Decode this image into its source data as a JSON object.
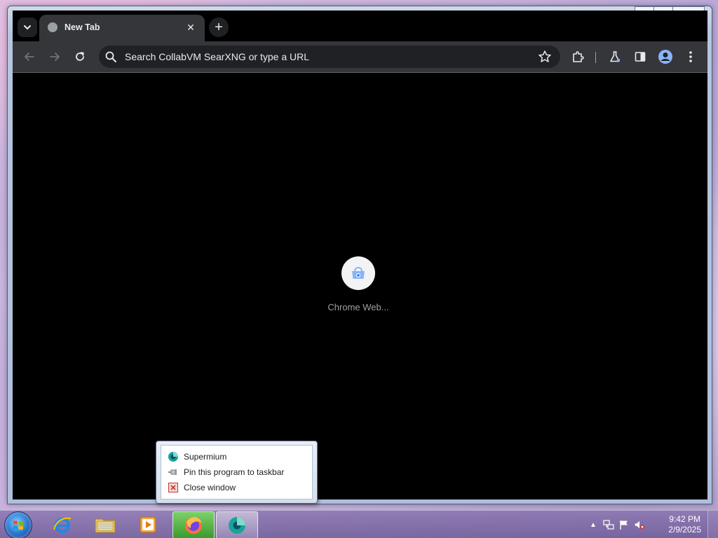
{
  "browser": {
    "tab": {
      "title": "New Tab",
      "close_glyph": "✕"
    },
    "new_tab_glyph": "+",
    "toolbar": {
      "omnibox_placeholder": "Search CollabVM SearXNG or type a URL"
    },
    "content": {
      "shortcut_label": "Chrome Web..."
    }
  },
  "window_caption": {
    "minimize_glyph": "▁",
    "maximize_glyph": "▢",
    "close_glyph": "✕"
  },
  "jumplist": {
    "items": [
      {
        "label": "Supermium",
        "icon": "supermium-icon"
      },
      {
        "label": "Pin this program to taskbar",
        "icon": "pin-icon"
      },
      {
        "label": "Close window",
        "icon": "close-window-icon"
      }
    ]
  },
  "taskbar": {
    "apps": [
      {
        "name": "internet-explorer",
        "icon": "ie-icon"
      },
      {
        "name": "file-explorer",
        "icon": "folder-icon"
      },
      {
        "name": "media-player",
        "icon": "media-player-icon"
      },
      {
        "name": "firefox",
        "icon": "firefox-icon"
      },
      {
        "name": "supermium",
        "icon": "supermium-icon"
      }
    ],
    "tray": {
      "overflow_glyph": "▲",
      "time": "9:42 PM",
      "date": "2/9/2025"
    }
  },
  "colors": {
    "browser_frame": "#35363a",
    "page_background": "#000000",
    "omnibox": "#202124",
    "text_light": "#e8eaed",
    "accent_blue": "#8ab4f8"
  }
}
